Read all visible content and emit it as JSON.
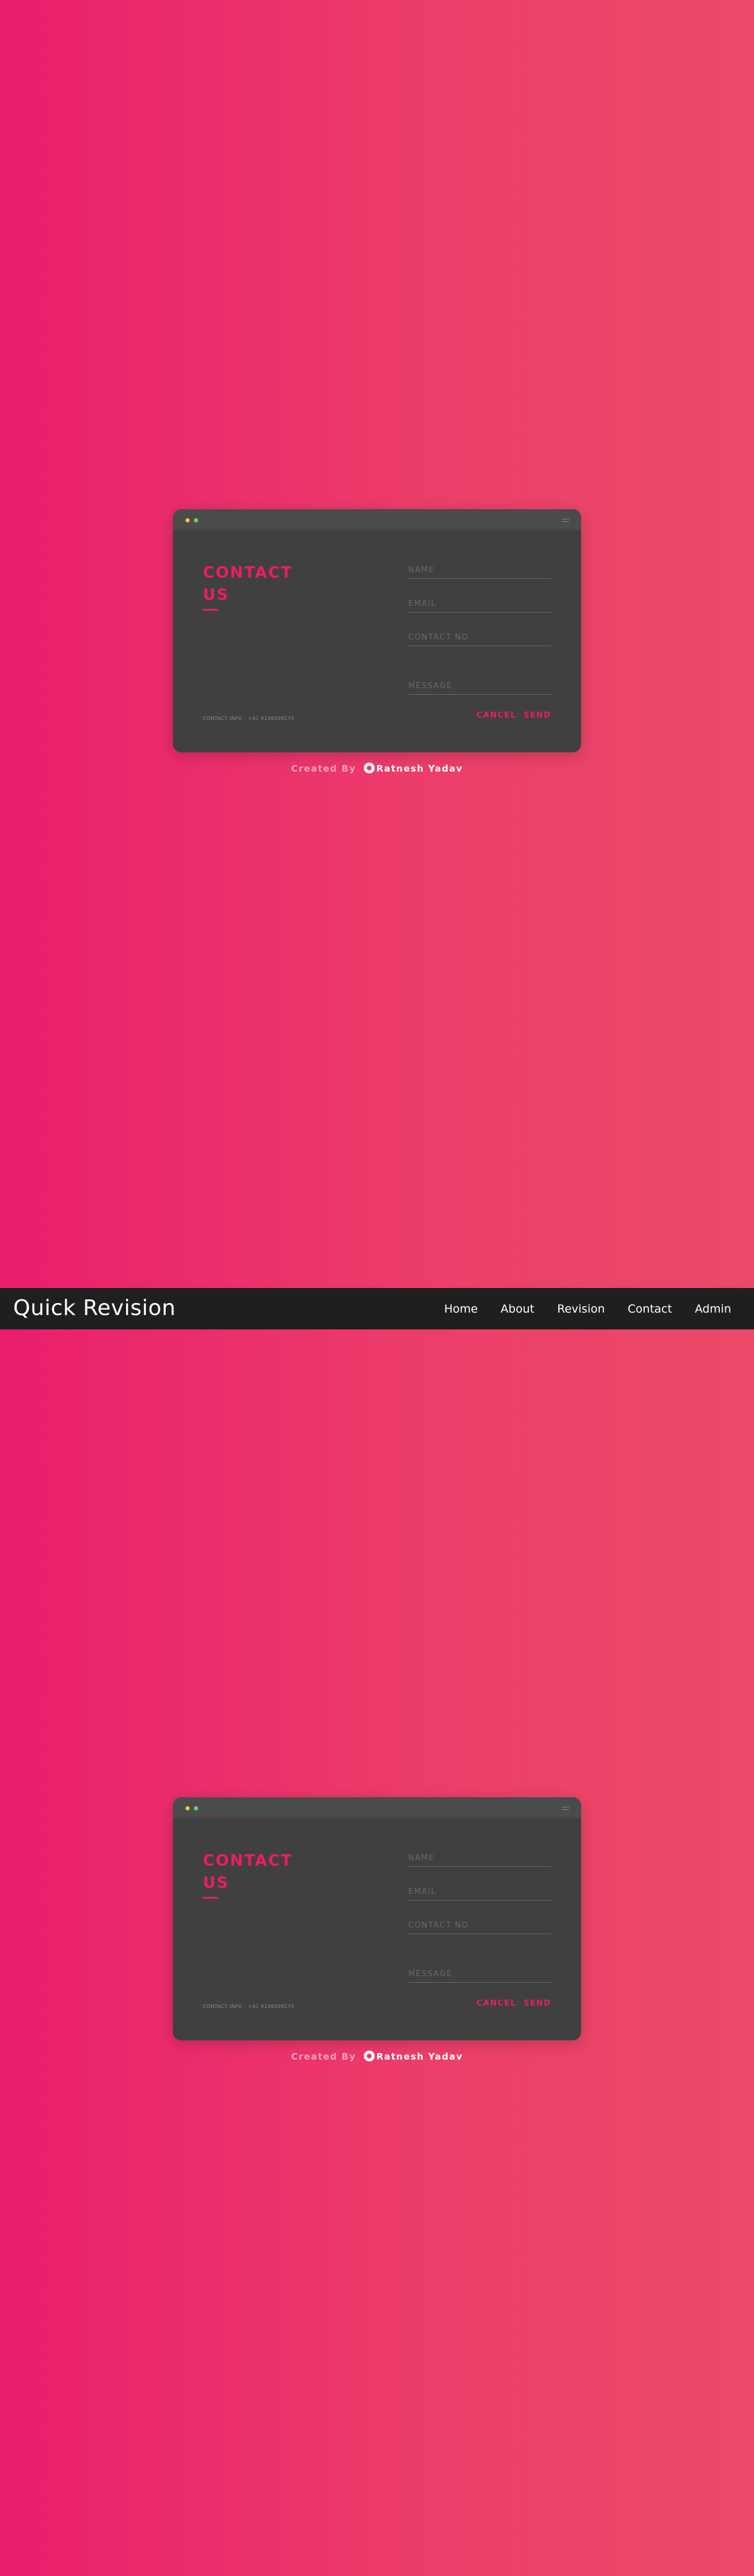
{
  "navbar": {
    "brand": "Quick Revision",
    "links": [
      "Home",
      "About",
      "Revision",
      "Contact",
      "Admin"
    ]
  },
  "contact_card": {
    "title_line1": "CONTACT",
    "title_line2": "US",
    "contact_info": "CONTACT INFO : +91 9198098179",
    "placeholders": {
      "name": "NAME",
      "email": "EMAIL",
      "contact_no": "CONTACT NO",
      "message": "MESSAGE"
    },
    "cancel_label": "CANCEL",
    "send_label": "SEND"
  },
  "credit": {
    "prefix": "Created By",
    "author": "Ratnesh Yadav"
  },
  "icons": {
    "window_dot_1": "yellow-dot-icon",
    "window_dot_2": "green-dot-icon",
    "menu": "hamburger-icon",
    "author_logo": "author-logo-icon"
  },
  "colors": {
    "accent": "#ea1e63",
    "card_bg": "#404040",
    "navbar_bg": "#1f1f1f",
    "background_gradient_start": "#e91e6c",
    "background_gradient_end": "#ea4a67"
  }
}
